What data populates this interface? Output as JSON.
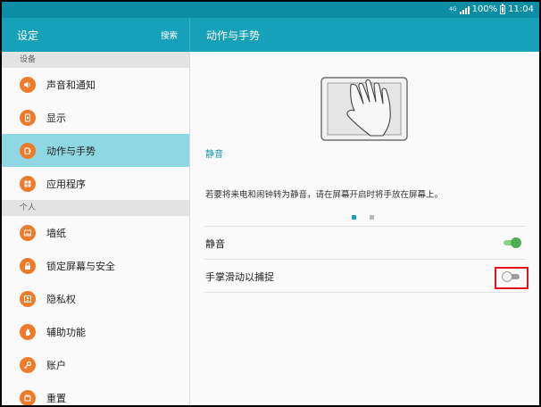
{
  "status_bar": {
    "network": "4G",
    "battery_percent": "100%",
    "time": "11:04",
    "icons": [
      "signal-icon",
      "battery-icon"
    ]
  },
  "left_header": {
    "title": "设定",
    "search": "搜索"
  },
  "right_header": {
    "title": "动作与手势"
  },
  "sidebar": {
    "sections": [
      {
        "header": "设备",
        "items": [
          {
            "label": "声音和通知",
            "icon": "volume-icon"
          },
          {
            "label": "显示",
            "icon": "display-icon"
          },
          {
            "label": "动作与手势",
            "icon": "motion-icon",
            "selected": true
          },
          {
            "label": "应用程序",
            "icon": "apps-icon"
          }
        ]
      },
      {
        "header": "个人",
        "items": [
          {
            "label": "墙纸",
            "icon": "wallpaper-icon"
          },
          {
            "label": "锁定屏幕与安全",
            "icon": "lock-icon"
          },
          {
            "label": "隐私权",
            "icon": "privacy-icon"
          },
          {
            "label": "辅助功能",
            "icon": "hand-icon"
          },
          {
            "label": "账户",
            "icon": "key-icon"
          },
          {
            "label": "重置",
            "icon": "reset-icon"
          }
        ]
      }
    ]
  },
  "main": {
    "illustration_icon": "palm-over-tablet-icon",
    "demo_title": "静音",
    "demo_description": "若要将来电和闹钟转为静音，请在屏幕开启时将手放在屏幕上。",
    "pagination": {
      "total": 2,
      "current": 1
    },
    "settings": [
      {
        "label": "静音",
        "enabled": true
      },
      {
        "label": "手掌滑动以捕捉",
        "enabled": false
      }
    ],
    "colors": {
      "accent": "#17a1b8",
      "selected_item": "#8fd7e3",
      "icon_bg": "#ee7b2c",
      "toggle_on": "#4caf50",
      "highlight": "#e0121b"
    }
  }
}
